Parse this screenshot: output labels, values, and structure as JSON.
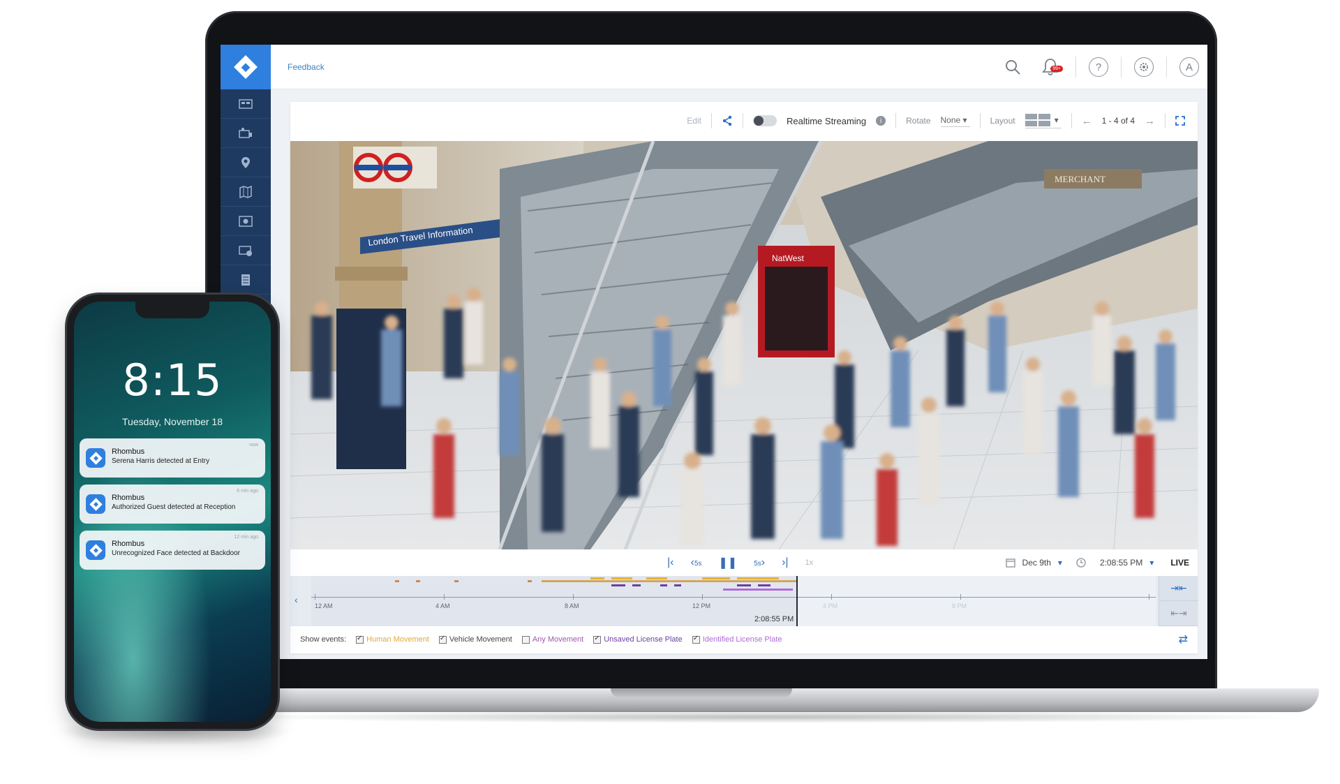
{
  "topbar": {
    "feedback": "Feedback",
    "notification_badge": "99+",
    "help_icon": "?",
    "avatar": "A"
  },
  "sidebar": {
    "items": [
      "dashboard-icon",
      "devices-icon",
      "location-icon",
      "map-icon",
      "video-wall-icon",
      "camera-icon",
      "report-icon"
    ]
  },
  "toolbar": {
    "edit": "Edit",
    "realtime_streaming": "Realtime Streaming",
    "info": "i",
    "rotate_label": "Rotate",
    "rotate_value": "None",
    "layout_label": "Layout",
    "pager": "1 - 4 of 4"
  },
  "video": {
    "sign_text": "London Travel Information",
    "bank_sign": "NatWest",
    "shop_sign": "MERCHANT"
  },
  "playback": {
    "skip_back": "5s",
    "skip_forward": "5s",
    "rate": "1x",
    "date": "Dec 9th",
    "time": "2:08:55 PM",
    "live": "LIVE"
  },
  "timeline": {
    "labels": [
      "12 AM",
      "4 AM",
      "8 AM",
      "12 PM",
      "4 PM",
      "8 PM"
    ],
    "cursor_time": "2:08:55 PM"
  },
  "events": {
    "label": "Show events:",
    "items": [
      {
        "label": "Human Movement",
        "checked": true,
        "color": "#e0a93a"
      },
      {
        "label": "Vehicle Movement",
        "checked": true,
        "color": "#444444"
      },
      {
        "label": "Any Movement",
        "checked": false,
        "color": "#9b59b6"
      },
      {
        "label": "Unsaved License Plate",
        "checked": true,
        "color": "#6b3fa0"
      },
      {
        "label": "Identified License Plate",
        "checked": true,
        "color": "#b06ad8"
      }
    ]
  },
  "phone": {
    "time": "8:15",
    "date": "Tuesday, November 18",
    "notifications": [
      {
        "app": "Rhombus",
        "message": "Serena Harris detected at Entry",
        "ago": "now"
      },
      {
        "app": "Rhombus",
        "message": "Authorized Guest detected at Reception",
        "ago": "6 min ago"
      },
      {
        "app": "Rhombus",
        "message": "Unrecognized Face detected at Backdoor",
        "ago": "12 min ago"
      }
    ]
  },
  "colors": {
    "brand_blue": "#2f7fde",
    "sidebar": "#1f3a60",
    "live_red": "#d82020"
  }
}
